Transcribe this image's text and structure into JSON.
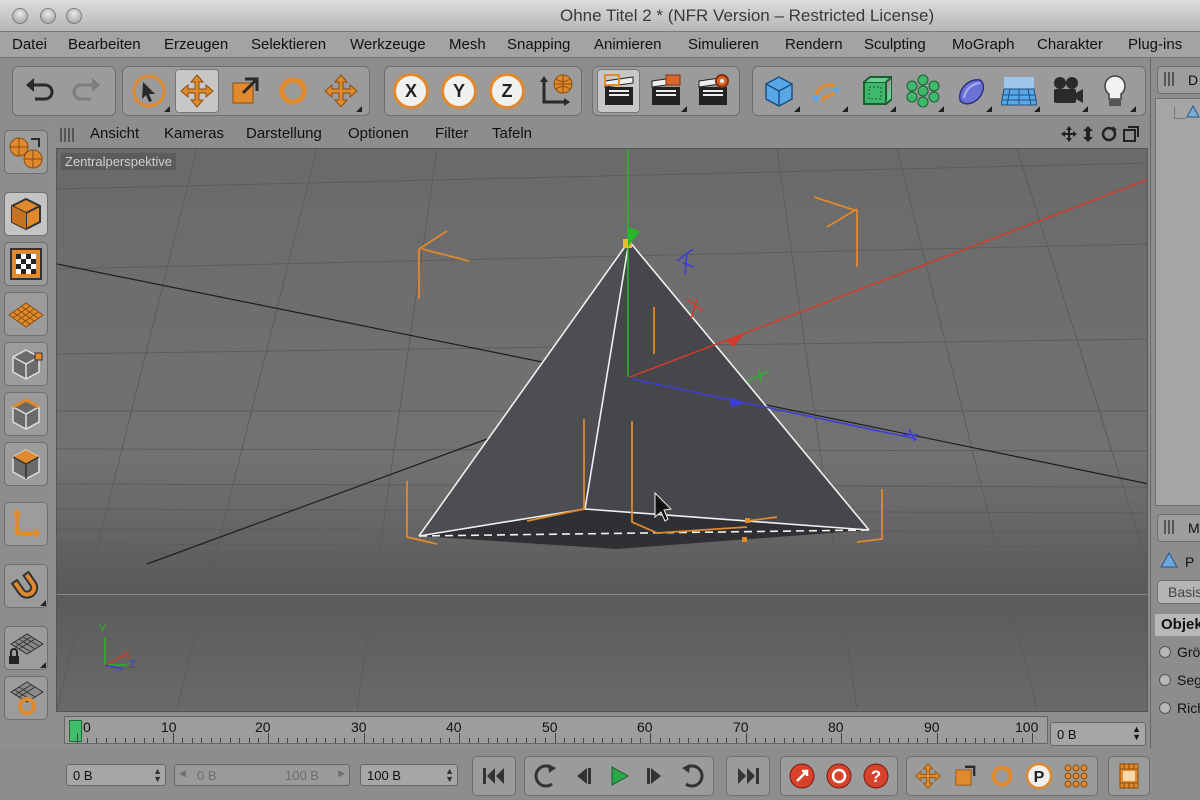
{
  "window": {
    "title": "Ohne Titel 2 * (NFR Version – Restricted License)"
  },
  "menu": [
    "Datei",
    "Bearbeiten",
    "Erzeugen",
    "Selektieren",
    "Werkzeuge",
    "Mesh",
    "Snapping",
    "Animieren",
    "Simulieren",
    "Rendern",
    "Sculpting",
    "MoGraph",
    "Charakter",
    "Plug-ins"
  ],
  "toolbar": {
    "axis_x": "X",
    "axis_y": "Y",
    "axis_z": "Z",
    "icons": [
      "undo-icon",
      "redo-icon",
      "select-icon",
      "move-icon",
      "scale-icon",
      "rotate-icon",
      "multi-move-icon",
      "lock-x-icon",
      "lock-y-icon",
      "lock-z-icon",
      "coordinate-system-icon",
      "render-view-icon",
      "render-picture-viewer-icon",
      "render-settings-icon",
      "cube-icon",
      "spline-icon",
      "subdivision-icon",
      "mograph-cloner-icon",
      "deformer-icon",
      "floor-icon",
      "camera-icon",
      "light-icon"
    ]
  },
  "viewport_menu": [
    "Ansicht",
    "Kameras",
    "Darstellung",
    "Optionen",
    "Filter",
    "Tafeln"
  ],
  "viewport": {
    "label": "Zentralperspektive",
    "axis_labels": {
      "y": "Y",
      "x": "X",
      "z": "Z"
    }
  },
  "right_panel": {
    "top_header": "D",
    "attr_header": "M",
    "object_short": "P",
    "tab_basis": "Basis",
    "section": "Objekt",
    "rows": [
      "Grö",
      "Seg",
      "Rich"
    ]
  },
  "timeline": {
    "ticks": [
      "0",
      "10",
      "20",
      "30",
      "40",
      "50",
      "60",
      "70",
      "80",
      "90",
      "100"
    ],
    "end_field": "0 B"
  },
  "bottom": {
    "current_frame": "0 B",
    "range_start": "0 B",
    "range_end": "100 B",
    "max_frame": "100 B"
  },
  "colors": {
    "accent_orange": "#e0892d",
    "axis_red": "#d23a2a",
    "axis_green": "#29b629",
    "axis_blue": "#3d3dd8"
  }
}
